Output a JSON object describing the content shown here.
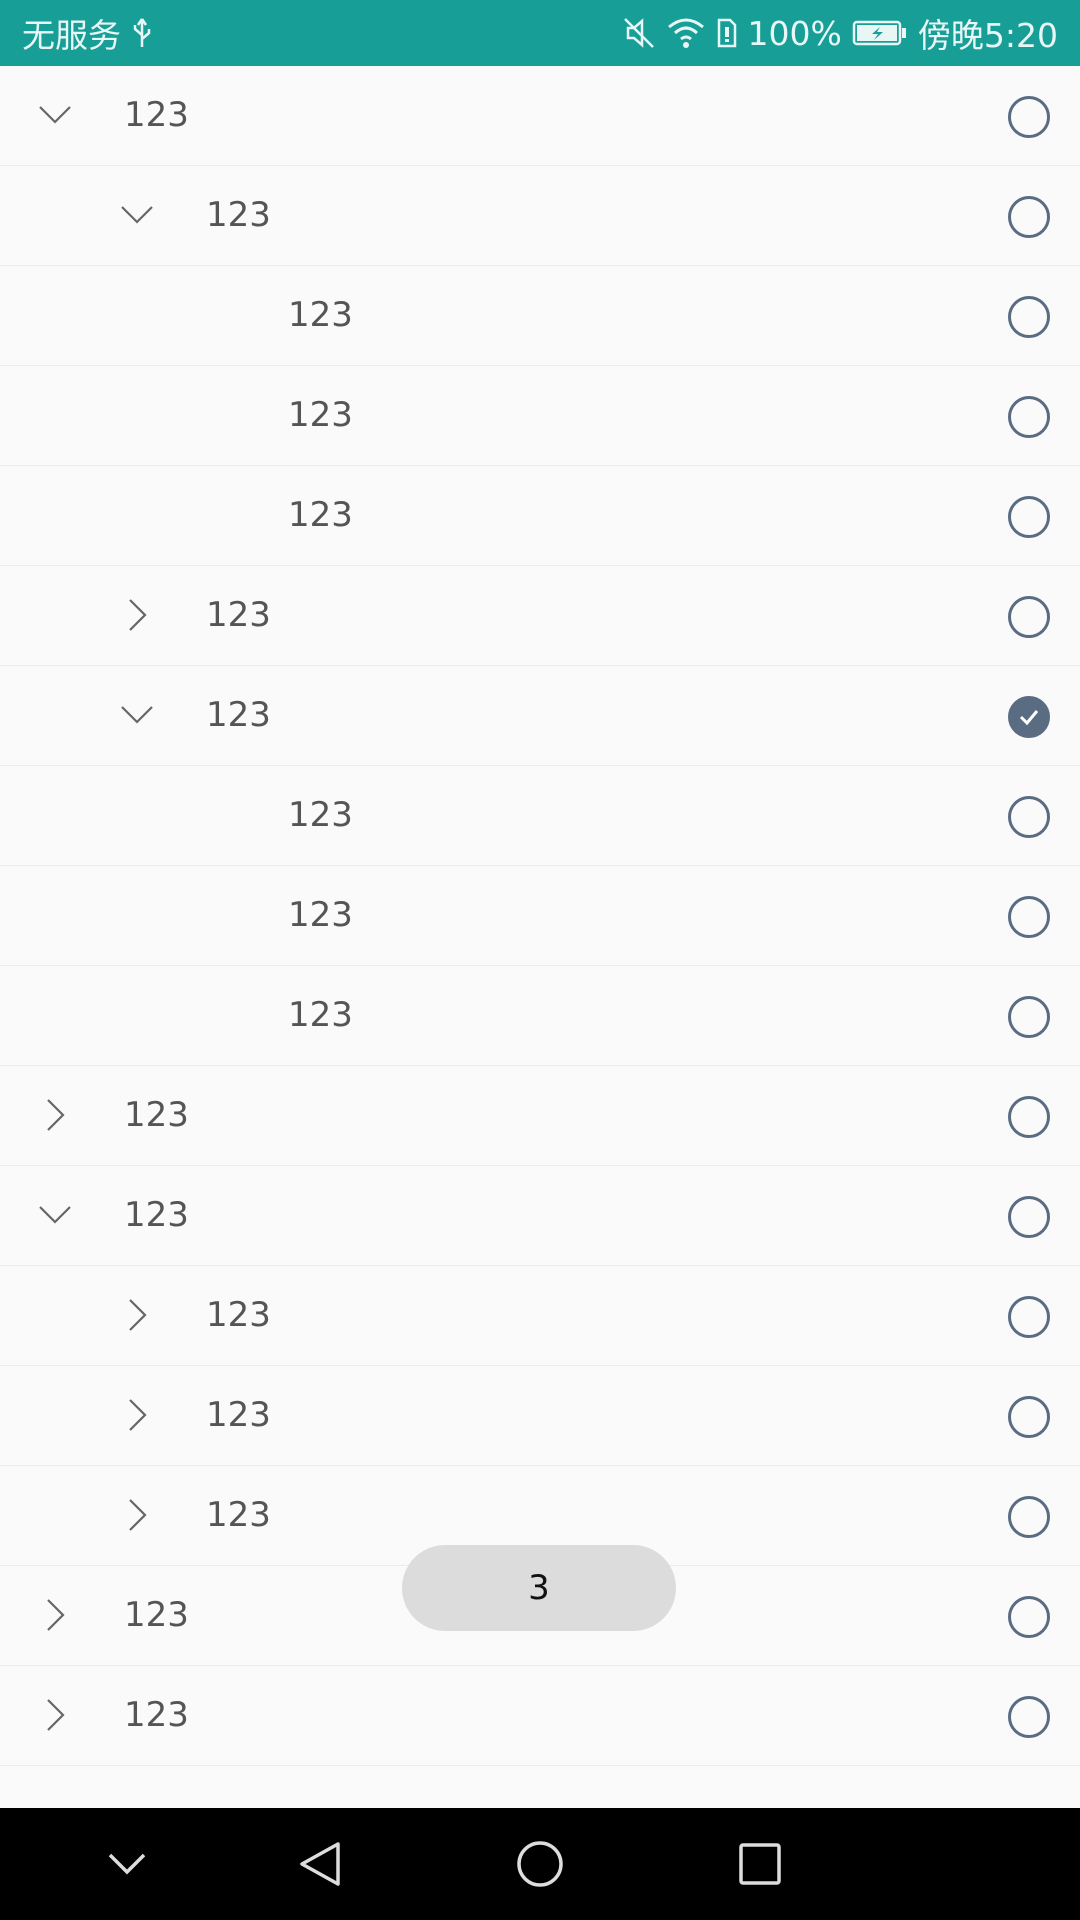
{
  "status_bar": {
    "carrier": "无服务",
    "battery_percent": "100%",
    "time": "傍晚5:20"
  },
  "tree": {
    "rows": [
      {
        "label": "123",
        "depth": 0,
        "arrow": "expanded",
        "checked": false
      },
      {
        "label": "123",
        "depth": 1,
        "arrow": "expanded",
        "checked": false
      },
      {
        "label": "123",
        "depth": 2,
        "arrow": "none",
        "checked": false
      },
      {
        "label": "123",
        "depth": 2,
        "arrow": "none",
        "checked": false
      },
      {
        "label": "123",
        "depth": 2,
        "arrow": "none",
        "checked": false
      },
      {
        "label": "123",
        "depth": 1,
        "arrow": "collapsed",
        "checked": false
      },
      {
        "label": "123",
        "depth": 1,
        "arrow": "expanded",
        "checked": true
      },
      {
        "label": "123",
        "depth": 2,
        "arrow": "none",
        "checked": false
      },
      {
        "label": "123",
        "depth": 2,
        "arrow": "none",
        "checked": false
      },
      {
        "label": "123",
        "depth": 2,
        "arrow": "none",
        "checked": false
      },
      {
        "label": "123",
        "depth": 0,
        "arrow": "collapsed",
        "checked": false
      },
      {
        "label": "123",
        "depth": 0,
        "arrow": "expanded",
        "checked": false
      },
      {
        "label": "123",
        "depth": 1,
        "arrow": "collapsed",
        "checked": false
      },
      {
        "label": "123",
        "depth": 1,
        "arrow": "collapsed",
        "checked": false
      },
      {
        "label": "123",
        "depth": 1,
        "arrow": "collapsed",
        "checked": false
      },
      {
        "label": "123",
        "depth": 0,
        "arrow": "collapsed",
        "checked": false
      },
      {
        "label": "123",
        "depth": 0,
        "arrow": "collapsed",
        "checked": false
      }
    ]
  },
  "toast": {
    "text": "3"
  },
  "colors": {
    "status_bar": "#179f97",
    "radio": "#5a6c82",
    "toast_bg": "#dcdcdc",
    "nav_bar": "#000000"
  },
  "nav_bar": {
    "icons": [
      "chevron-down-icon",
      "back-triangle-icon",
      "home-circle-icon",
      "recents-square-icon"
    ]
  }
}
